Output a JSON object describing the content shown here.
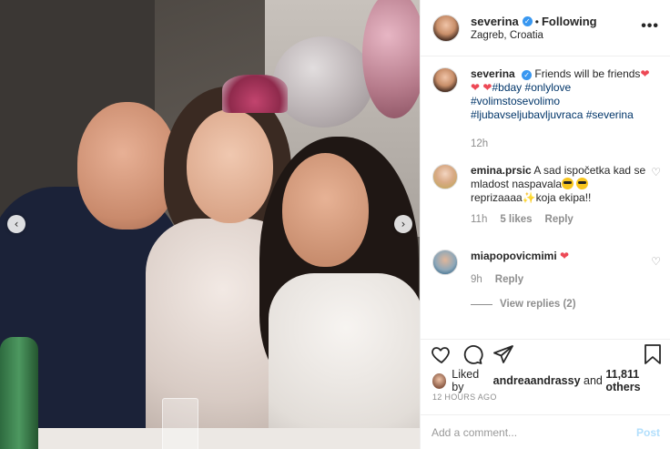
{
  "post": {
    "author": "severina",
    "following_label": "Following",
    "separator": "•",
    "location": "Zagreb, Croatia",
    "more_icon": "more-horizontal-icon",
    "verified_icon": "verified-badge-icon"
  },
  "caption": {
    "username": "severina",
    "text_1": "Friends will be friends",
    "tag_bday": "#bday",
    "tag_onlylove": "#onlylove",
    "tag_volim": "#volimstosevolimo",
    "tag_ljub": "#ljubavseljubavljuvraca",
    "tag_sev": "#severina",
    "time": "12h",
    "heart": "❤"
  },
  "comments": [
    {
      "username": "emina.prsic",
      "text_a": "A sad ispočetka kad se mladost naspavala",
      "text_b": "reprizaaaa",
      "text_c": "koja ekipa!!",
      "time": "11h",
      "likes": "5 likes",
      "reply": "Reply",
      "sparkle": "✨"
    },
    {
      "username": "miapopovicmimi",
      "heart": "❤",
      "time": "9h",
      "reply": "Reply",
      "view_replies": "View replies (2)"
    }
  ],
  "footer": {
    "liked_by_prefix": "Liked by",
    "liked_by_user": "andreaandrassy",
    "and": "and",
    "liked_count": "11,811 others",
    "timestamp": "12 HOURS AGO",
    "comment_placeholder": "Add a comment...",
    "post_label": "Post"
  },
  "photo_nav": {
    "left": "‹",
    "right": "›"
  },
  "colors": {
    "verified": "#3897f0",
    "heart": "#ed4956",
    "hashtag": "#003569",
    "muted": "#8e8e8e",
    "post_disabled": "#b2dffc"
  }
}
